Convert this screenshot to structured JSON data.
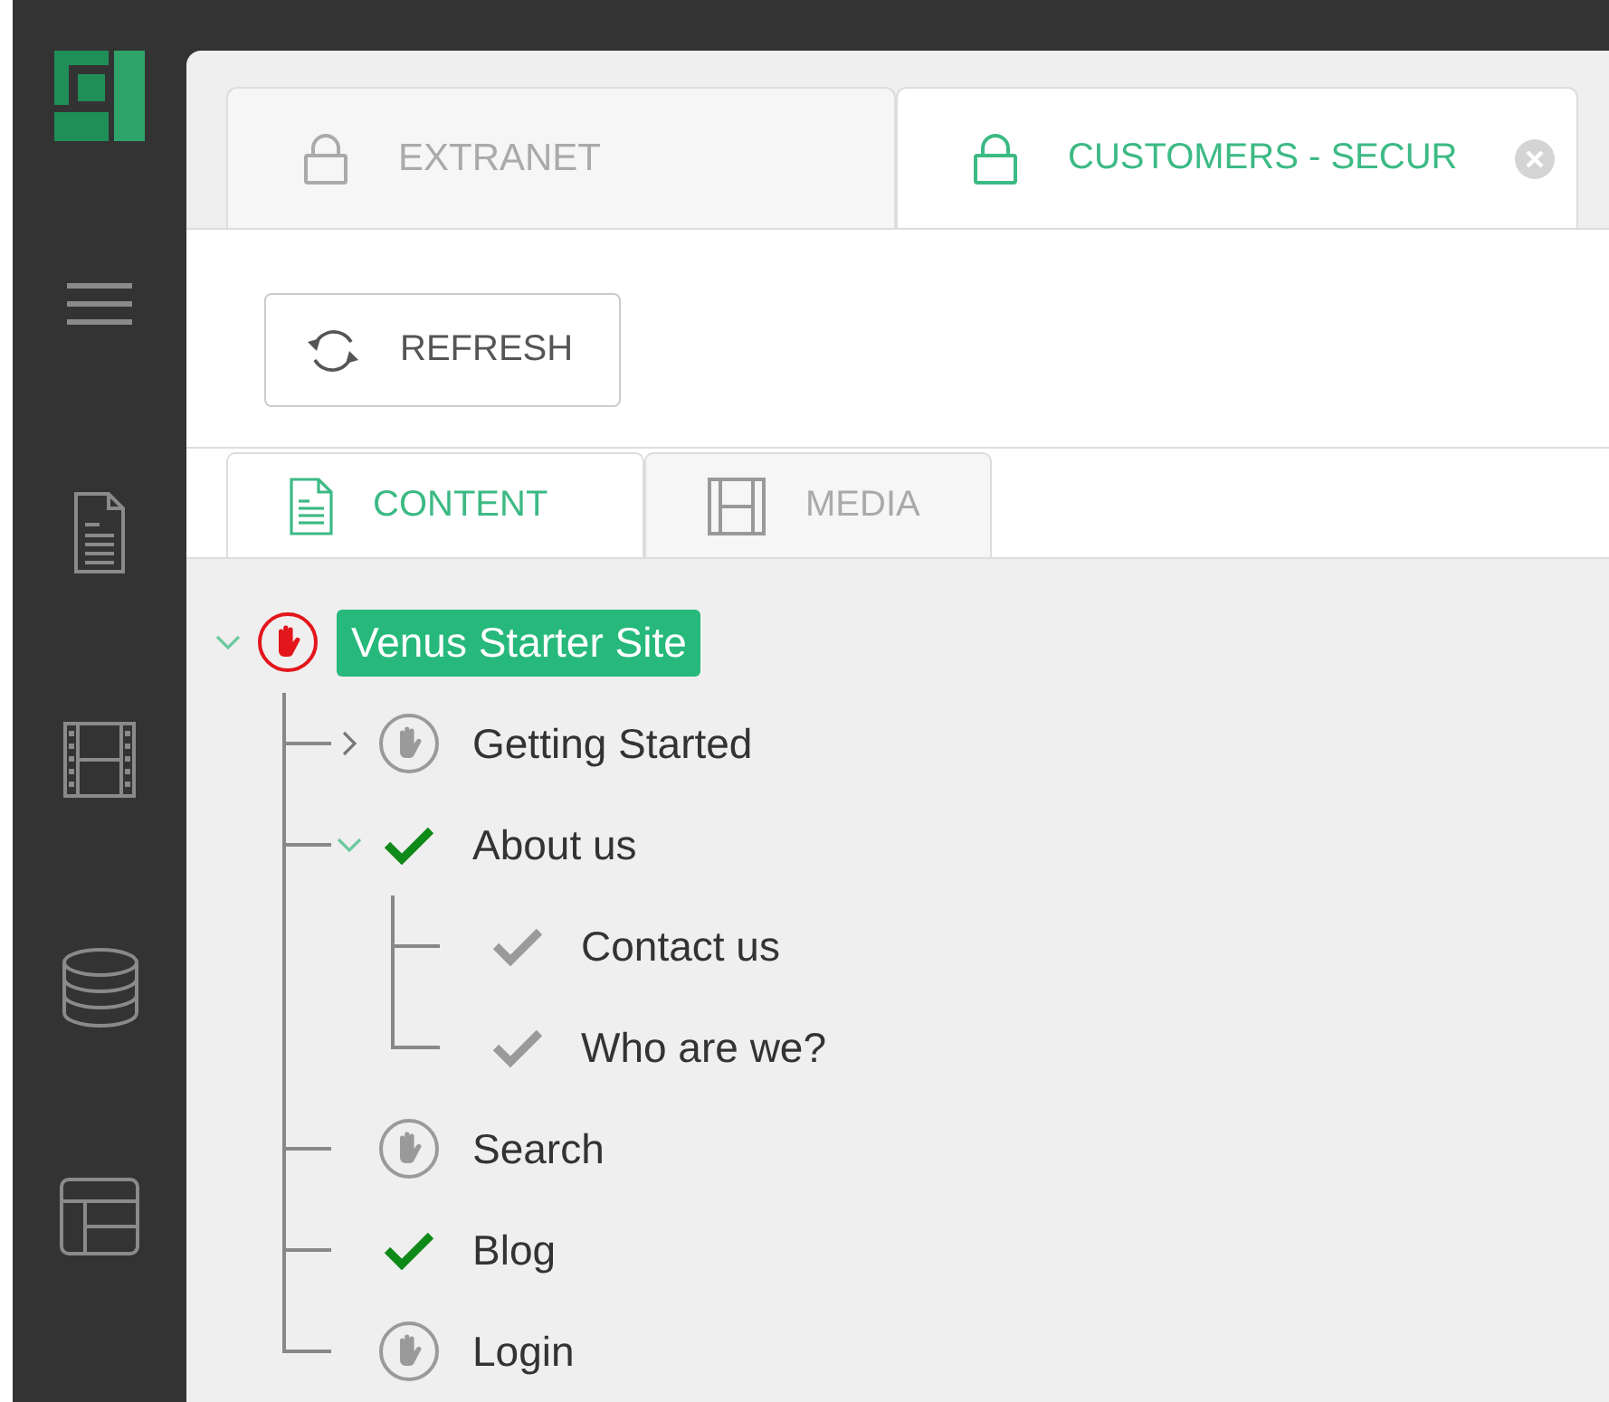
{
  "tabs": [
    {
      "label": "EXTRANET",
      "selected": false,
      "closable": false
    },
    {
      "label": "CUSTOMERS - SECUR",
      "selected": true,
      "closable": true
    }
  ],
  "toolbar": {
    "buttons": [
      "REFRESH"
    ]
  },
  "content_tabs": [
    {
      "label": "CONTENT",
      "kind": "content",
      "selected": true
    },
    {
      "label": "MEDIA",
      "kind": "media",
      "selected": false
    }
  ],
  "tree": {
    "label": "Venus Starter Site",
    "kind": "stop",
    "inherited": false,
    "selected": true,
    "expanded": true,
    "children": [
      {
        "label": "Getting Started",
        "kind": "stop",
        "inherited": true,
        "selected": false,
        "expanded": false
      },
      {
        "label": "About us",
        "kind": "check",
        "inherited": false,
        "selected": false,
        "expanded": true,
        "children": [
          {
            "label": "Contact us",
            "kind": "check",
            "inherited": true,
            "selected": false
          },
          {
            "label": "Who are we?",
            "kind": "check",
            "inherited": true,
            "selected": false
          }
        ]
      },
      {
        "label": "Search",
        "kind": "stop",
        "inherited": true,
        "selected": false
      },
      {
        "label": "Blog",
        "kind": "check",
        "inherited": false,
        "selected": false
      },
      {
        "label": "Login",
        "kind": "stop",
        "inherited": true,
        "selected": false
      }
    ]
  }
}
